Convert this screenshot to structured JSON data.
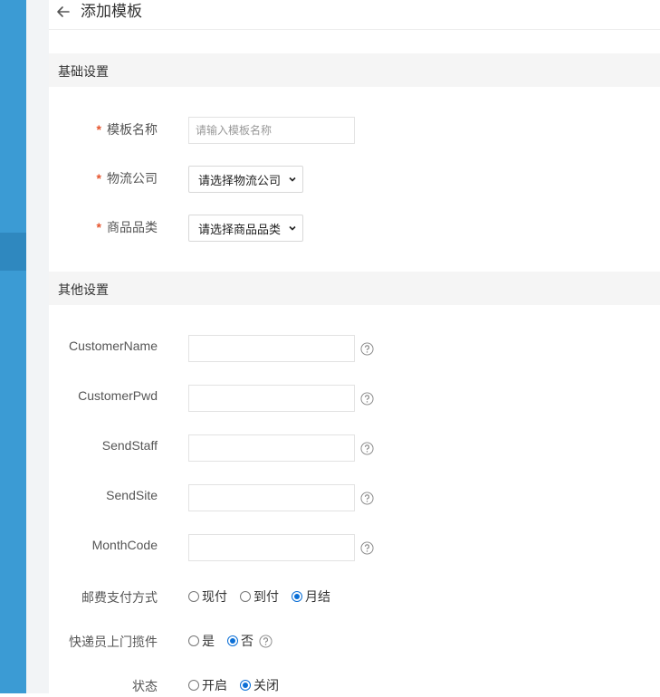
{
  "header": {
    "title": "添加模板"
  },
  "sections": {
    "basic": "基础设置",
    "other": "其他设置"
  },
  "basic": {
    "template_name": {
      "label": "模板名称",
      "placeholder": "请输入模板名称"
    },
    "logistics_company": {
      "label": "物流公司",
      "selected": "请选择物流公司"
    },
    "product_category": {
      "label": "商品品类",
      "selected": "请选择商品品类"
    }
  },
  "other": {
    "customer_name": {
      "label": "CustomerName",
      "value": ""
    },
    "customer_pwd": {
      "label": "CustomerPwd",
      "value": ""
    },
    "send_staff": {
      "label": "SendStaff",
      "value": ""
    },
    "send_site": {
      "label": "SendSite",
      "value": ""
    },
    "month_code": {
      "label": "MonthCode",
      "value": ""
    },
    "postage_payment": {
      "label": "邮费支付方式",
      "options": [
        "现付",
        "到付",
        "月结"
      ],
      "selected": "月结"
    },
    "courier_pickup": {
      "label": "快递员上门揽件",
      "options": [
        "是",
        "否"
      ],
      "selected": "否"
    },
    "status": {
      "label": "状态",
      "options": [
        "开启",
        "关闭"
      ],
      "selected": "关闭"
    }
  },
  "required_mark": "*",
  "colors": {
    "sidebar": "#3b9bd4",
    "accent": "#0b6fd6",
    "required": "#e6552e"
  }
}
